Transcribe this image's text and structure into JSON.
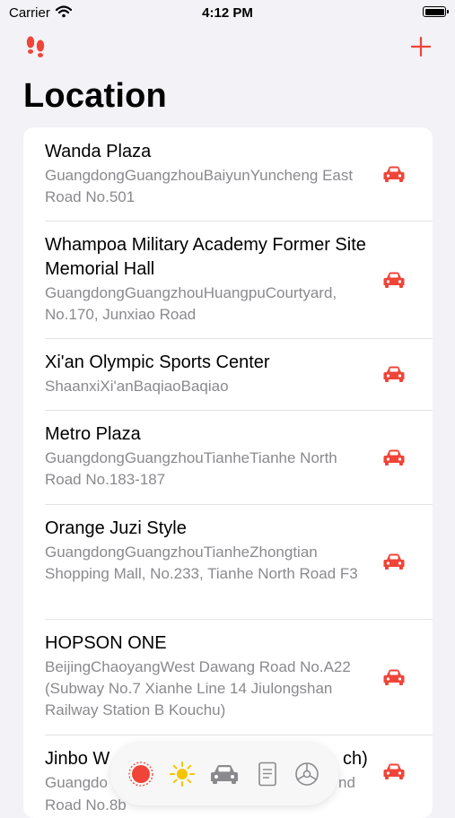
{
  "status": {
    "carrier": "Carrier",
    "time": "4:12 PM"
  },
  "header": {
    "title": "Location"
  },
  "locations": [
    {
      "name": "Wanda Plaza",
      "address": "GuangdongGuangzhouBaiyunYuncheng East Road No.501"
    },
    {
      "name": "Whampoa Military Academy Former Site Memorial Hall",
      "address": "GuangdongGuangzhouHuangpuCourtyard, No.170, Junxiao Road"
    },
    {
      "name": "Xi'an Olympic Sports Center",
      "address": "ShaanxiXi'anBaqiaoBaqiao"
    },
    {
      "name": "Metro Plaza",
      "address": "GuangdongGuangzhouTianheTianhe North Road No.183-187"
    },
    {
      "name": "Orange Juzi Style",
      "address": "GuangdongGuangzhouTianheZhongtian Shopping Mall, No.233, Tianhe North Road F3"
    },
    {
      "name": "HOPSON ONE",
      "address": "BeijingChaoyangWest Dawang Road No.A22 (Subway No.7 Xianhe Line 14 Jiulongshan Railway Station B Kouchu)"
    },
    {
      "name": "Jinbo W",
      "name_tail": "ch)",
      "address": "Guangdo",
      "address_tail": "nd",
      "address_line2": "Road No.8b"
    }
  ],
  "toolbar": {
    "items": [
      "record-icon",
      "sun-icon",
      "car-icon",
      "document-icon",
      "settings-icon"
    ]
  },
  "colors": {
    "accent": "#f04438",
    "background": "#f2f2f7",
    "secondary_text": "#8a8a8e",
    "sun": "#f5c400"
  }
}
